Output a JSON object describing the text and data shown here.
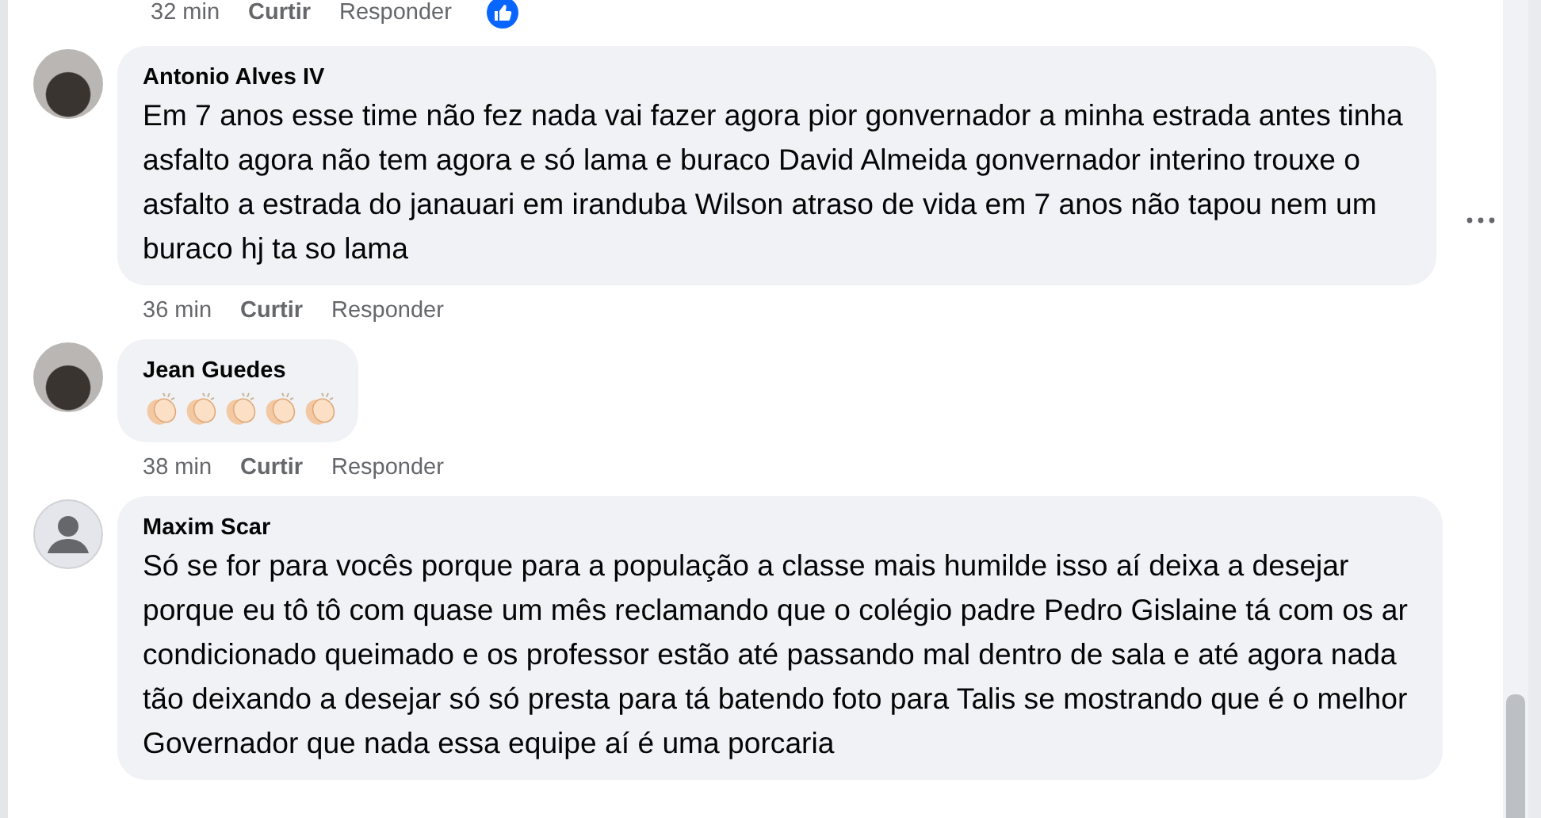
{
  "previous_comment_meta": {
    "time": "32 min",
    "like": "Curtir",
    "reply": "Responder",
    "reaction": {
      "kind": "like"
    }
  },
  "comments": [
    {
      "author": "Antonio Alves IV",
      "avatar": {
        "kind": "photo"
      },
      "text": "Em 7 anos esse time não fez nada vai fazer agora pior gonvernador a minha estrada antes tinha asfalto agora não tem agora e só lama e buraco David Almeida gonvernador interino trouxe o asfalto a estrada do janauari em iranduba Wilson atraso de vida em 7 anos não tapou nem um buraco hj ta so lama",
      "time": "36 min",
      "like": "Curtir",
      "reply": "Responder",
      "more_menu": true
    },
    {
      "author": "Jean Guedes",
      "avatar": {
        "kind": "photo"
      },
      "emojis": [
        {
          "kind": "clap"
        },
        {
          "kind": "clap"
        },
        {
          "kind": "clap"
        },
        {
          "kind": "clap"
        },
        {
          "kind": "clap"
        }
      ],
      "time": "38 min",
      "like": "Curtir",
      "reply": "Responder",
      "more_menu": false
    },
    {
      "author": "Maxim Scar",
      "avatar": {
        "kind": "default"
      },
      "text": "Só se for para vocês porque para a população a classe mais humilde isso aí deixa a desejar porque eu tô tô com quase um mês reclamando que o colégio padre Pedro Gislaine tá com os ar condicionado queimado e os professor estão até passando mal dentro de sala e até agora nada tão deixando a desejar só só presta para tá batendo foto para Talis se mostrando que é o melhor Governador que nada essa equipe aí é uma porcaria",
      "more_menu": false
    }
  ]
}
